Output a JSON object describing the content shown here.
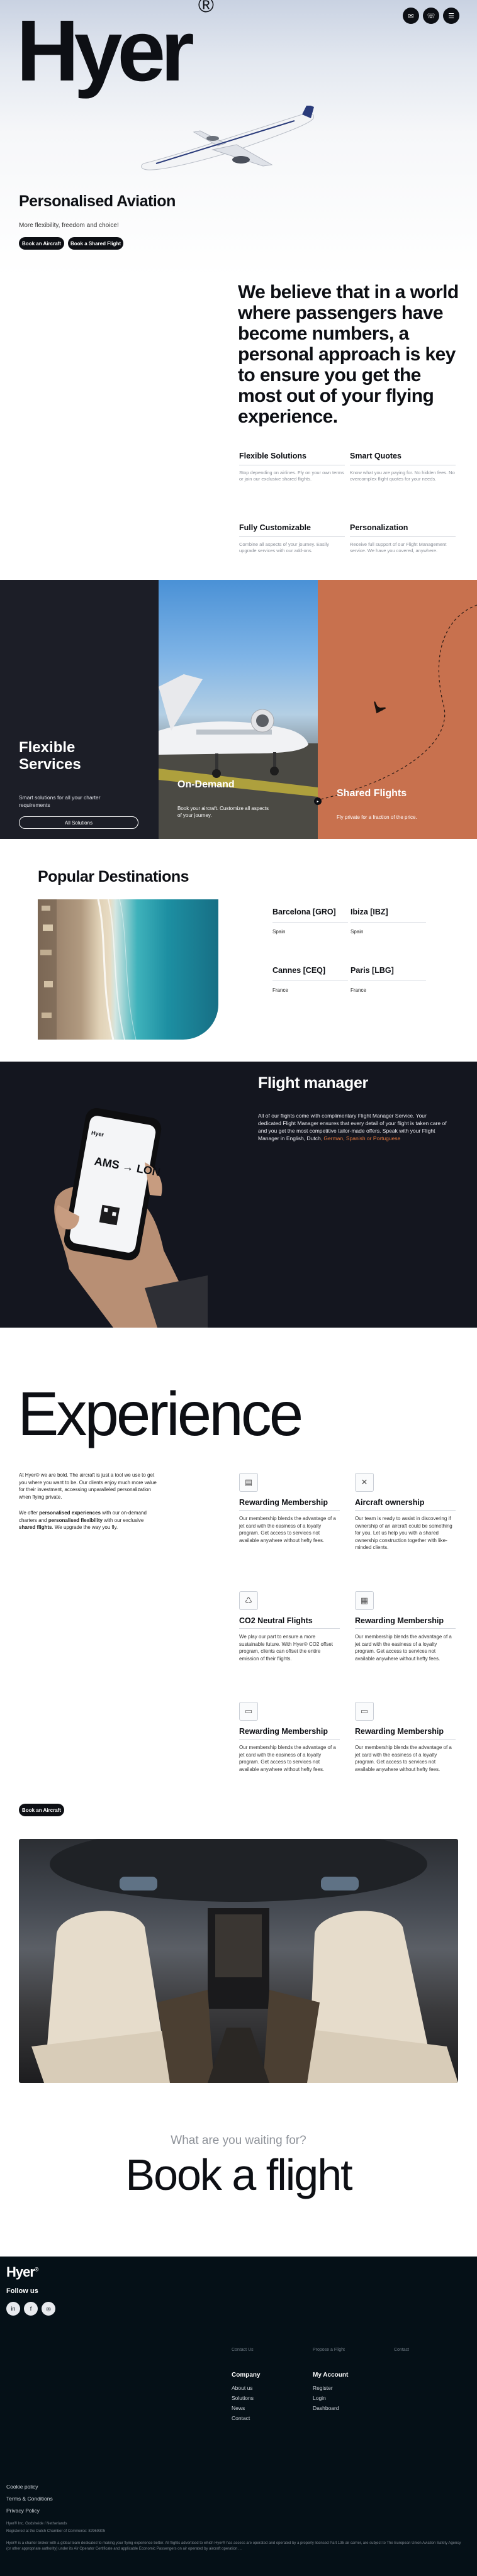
{
  "brand": {
    "logo": "Hyer",
    "registered": "®"
  },
  "header_buttons": [
    "✉",
    "☏",
    "☰"
  ],
  "hero": {
    "title": "Personalised Aviation",
    "subtitle": "More flexibility, freedom and choice!",
    "btn_book": "Book an Aircraft",
    "btn_shared": "Book a Shared Flight"
  },
  "belief": {
    "headline": "We believe that in a world where passengers have become numbers, a personal approach is key to ensure you get the most out of your flying experience.",
    "features": [
      {
        "title": "Flexible Solutions",
        "desc": "Stop depending on airlines. Fly on your own terms or join our exclusive shared flights."
      },
      {
        "title": "Smart Quotes",
        "desc": "Know what you are paying for. No hidden fees. No overcomplex flight quotes for your needs."
      },
      {
        "title": "Fully Customizable",
        "desc": "Combine all aspects of your journey. Easily upgrade services with our add-ons."
      },
      {
        "title": "Personalization",
        "desc": "Receive full support of our Flight Management service. We have you covered, anywhere."
      }
    ]
  },
  "services": {
    "flexible": {
      "title_line1": "Flexible",
      "title_line2": "Services",
      "desc": "Smart solutions for all your charter requirements",
      "btn": "All Solutions"
    },
    "ondemand": {
      "title": "On-Demand",
      "desc": "Book your aircraft. Customize all aspects of your journey."
    },
    "shared": {
      "title": "Shared Flights",
      "desc": "Fly private for a fraction of the price."
    }
  },
  "destinations": {
    "title": "Popular Destinations",
    "items": [
      {
        "name": "Barcelona [GRO]",
        "country": "Spain"
      },
      {
        "name": "Ibiza [IBZ]",
        "country": "Spain"
      },
      {
        "name": "Cannes [CEQ]",
        "country": "France"
      },
      {
        "name": "Paris [LBG]",
        "country": "France"
      }
    ]
  },
  "flight_manager": {
    "title": "Flight manager",
    "text": "All of our flights come with complimentary Flight Manager Service. Your dedicated Flight Manager ensures that every detail of your flight is taken care of and you get the most competitive tailor-made offers. Speak with your Flight Manager in English, Dutch",
    "text_langs": ", German, Spanish or Portuguese",
    "phone": {
      "app": "Hyer",
      "from": "AMS",
      "to": "LON",
      "arrow": "→"
    }
  },
  "experience": {
    "title": "Experience",
    "p1": "At Hyer® we are bold. The aircraft is just a tool we use to get you where you want to be. Our clients enjoy much more value for their investment, accessing unparalleled personalization when flying private.",
    "p2_a": "We offer ",
    "p2_b": "personalised experiences",
    "p2_c": " with our on-demand charters and ",
    "p2_d": "personalised flexibility",
    "p2_e": " with our exclusive ",
    "p2_f": "shared flights",
    "p2_g": ". We upgrade the way you fly.",
    "btn": "Book an Aircraft",
    "cards": [
      {
        "icon": "▤",
        "title": "Rewarding Membership",
        "desc": "Our membership blends the advantage of a jet card with the easiness of a loyalty program. Get access to services not available anywhere without hefty fees."
      },
      {
        "icon": "✕",
        "title": "Aircraft ownership",
        "desc": "Our team is ready to assist in discovering if ownership of an aircraft could be something for you. Let us help you with a shared ownership construction together with like-minded clients."
      },
      {
        "icon": "♺",
        "title": "CO2 Neutral Flights",
        "desc": "We play our part to ensure a more sustainable future. With Hyer® CO2 offset program, clients can offset the entire emission of their flights."
      },
      {
        "icon": "▦",
        "title": "Rewarding Membership",
        "desc": "Our membership blends the advantage of a jet card with the easiness of a loyalty program. Get access to services not available anywhere without hefty fees."
      },
      {
        "icon": "▭",
        "title": "Rewarding Membership",
        "desc": "Our membership blends the advantage of a jet card with the easiness of a loyalty program. Get access to services not available anywhere without hefty fees."
      },
      {
        "icon": "▭",
        "title": "Rewarding Membership",
        "desc": "Our membership blends the advantage of a jet card with the easiness of a loyalty program. Get access to services not available anywhere without hefty fees."
      }
    ]
  },
  "cta": {
    "pre": "What are you waiting for?",
    "title": "Book a flight"
  },
  "footer": {
    "logo": "Hyer",
    "registered": "®",
    "follow": "Follow us",
    "social": [
      "in",
      "f",
      "◎"
    ],
    "top_small": [
      "Contact Us",
      "Propose a Flight",
      "Contact"
    ],
    "company_head": "Company",
    "company_links": [
      "About us",
      "Solutions",
      "News",
      "Contact"
    ],
    "account_head": "My Account",
    "account_links": [
      "Register",
      "Login",
      "Dashboard"
    ],
    "legal": [
      "Cookie policy",
      "Terms & Conditions",
      "Privacy Policy"
    ],
    "copyright": "Hyer® Inc. Godsheide / Netherlands",
    "registered_in": "Registered at the Dutch Chamber of Commerce: 82969305",
    "fine": "Hyer® is a charter broker with a global team dedicated to making your flying experience better. All flights advertised to which Hyer® has access are operated and operated by a properly licensed Part 135 air carrier, are subject to The European Union Aviation Safety Agency (or other appropriate authority) under its Air Operator Certificate and applicable Economic Passengers on air operated by aircraft operation ..."
  },
  "colors": {
    "dark": "#0d0f14",
    "navy": "#1c1e27",
    "terracotta": "#c8714e",
    "orange": "#e0773e",
    "footer": "#051017"
  }
}
